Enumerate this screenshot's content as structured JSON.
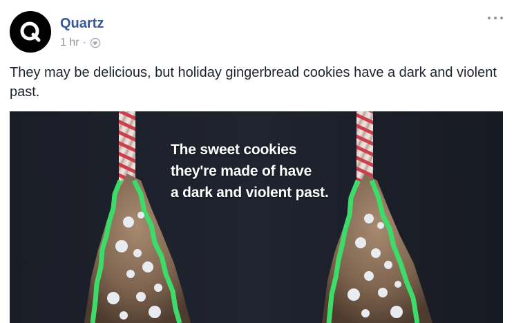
{
  "post": {
    "page_name": "Quartz",
    "avatar_letter": "Q",
    "timestamp": "1 hr",
    "separator": "·",
    "audience_icon": "globe-icon",
    "more_icon": "more-options-icon",
    "text": "They may be delicious, but holiday gingerbread cookies have a dark and violent past."
  },
  "media": {
    "caption_lines": [
      "The sweet cookies",
      "they're made of have",
      "a dark and violent past."
    ]
  },
  "colors": {
    "page_name": "#365899",
    "meta_text": "#90949c",
    "body_text": "#1d2129",
    "media_background": "#15181f",
    "icing_green": "#3ddc6a"
  }
}
